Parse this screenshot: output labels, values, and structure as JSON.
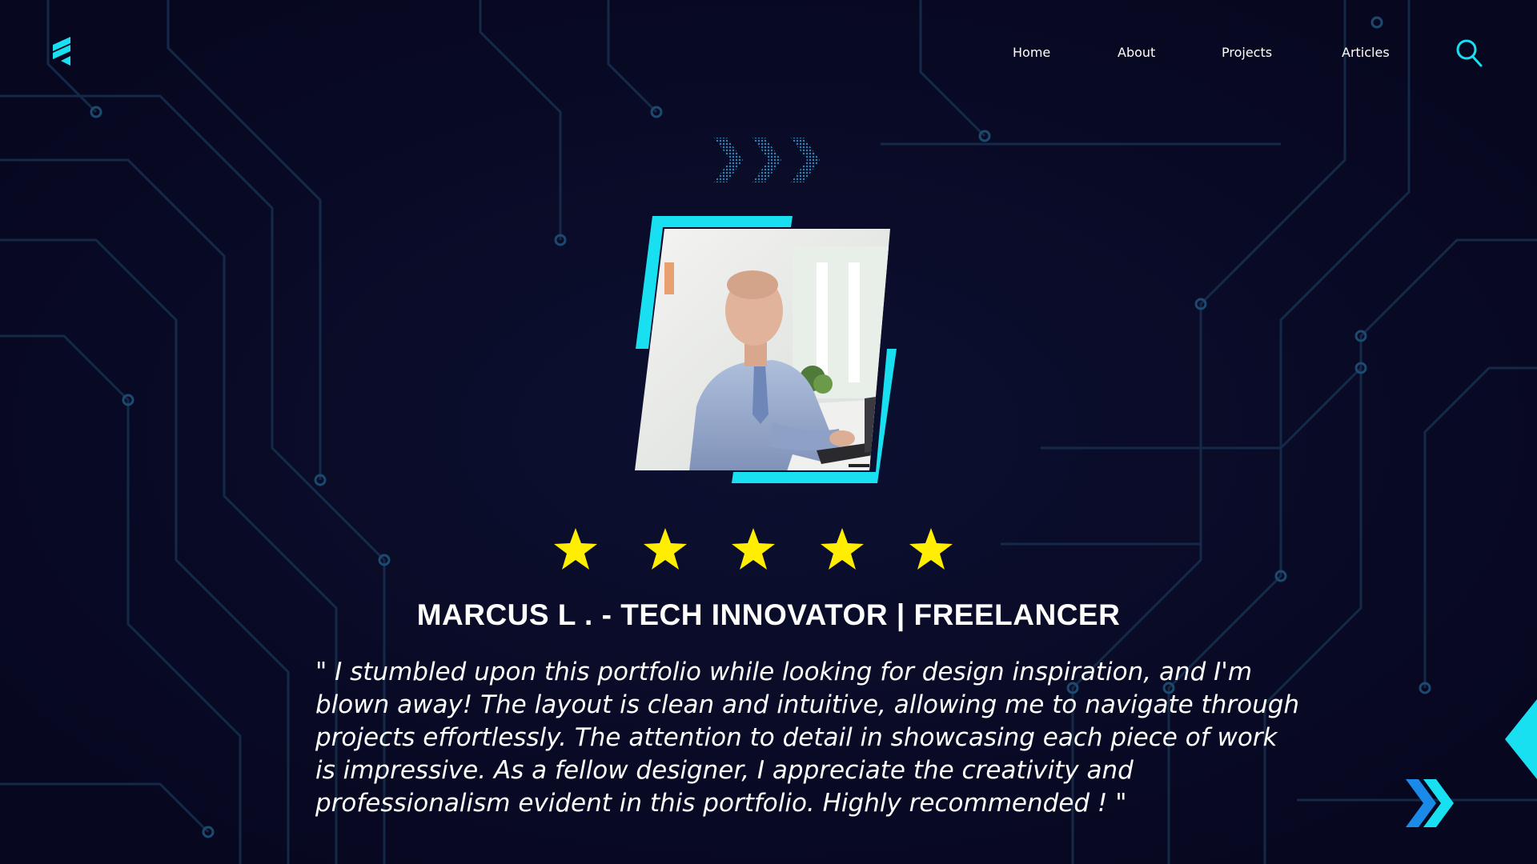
{
  "colors": {
    "background": "#0a0a24",
    "accent": "#18e0f0",
    "star": "#ffee00",
    "circuit": "#1a3a5a"
  },
  "brand": {
    "logo_icon": "brand-logo-icon"
  },
  "nav": {
    "items": [
      {
        "label": "Home"
      },
      {
        "label": "About"
      },
      {
        "label": "Projects"
      },
      {
        "label": "Articles"
      }
    ],
    "search_icon": "search-icon"
  },
  "testimonial": {
    "rating": 5,
    "rating_max": 5,
    "name": "MARCUS L . - TECH INNOVATOR | FREELANCER",
    "quote_lines": [
      "\" I stumbled upon this portfolio while looking for design inspiration, and I'm",
      "blown away! The layout is clean and intuitive, allowing me to navigate through",
      "projects effortlessly. The attention to detail in showcasing each piece of work",
      "is impressive. As a fellow designer, I appreciate the creativity and",
      "professionalism evident in this portfolio. Highly recommended ! \""
    ]
  },
  "controls": {
    "next_icon": "double-chevron-right-icon",
    "decor_icon": "chevron-arrows-icon"
  }
}
